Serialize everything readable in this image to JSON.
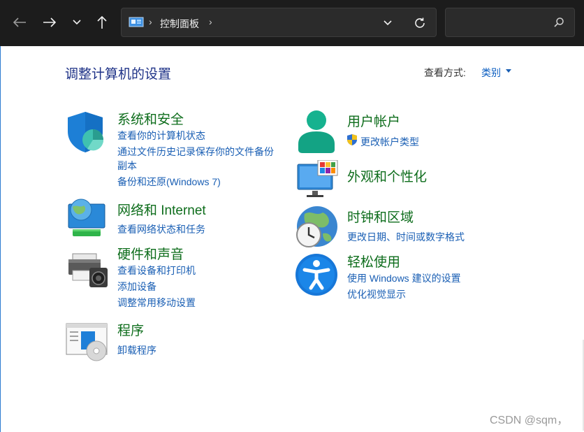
{
  "nav": {
    "address_root": "控制面板",
    "search_placeholder": ""
  },
  "page": {
    "title": "调整计算机的设置",
    "view_by_label": "查看方式:",
    "view_by_value": "类别"
  },
  "categories": {
    "system": {
      "title": "系统和安全",
      "links": [
        "查看你的计算机状态",
        "通过文件历史记录保存你的文件备份",
        "副本",
        "备份和还原(Windows 7)"
      ]
    },
    "network": {
      "title": "网络和 Internet",
      "links": [
        "查看网络状态和任务"
      ]
    },
    "hardware": {
      "title": "硬件和声音",
      "links": [
        "查看设备和打印机",
        "添加设备",
        "调整常用移动设置"
      ]
    },
    "programs": {
      "title": "程序",
      "links": [
        "卸载程序"
      ]
    },
    "users": {
      "title": "用户帐户",
      "links": [
        "更改帐户类型"
      ]
    },
    "appearance": {
      "title": "外观和个性化",
      "links": []
    },
    "clock": {
      "title": "时钟和区域",
      "links": [
        "更改日期、时间或数字格式"
      ]
    },
    "ease": {
      "title": "轻松使用",
      "links": [
        "使用 Windows 建议的设置",
        "优化视觉显示"
      ]
    }
  },
  "watermark": "CSDN @sqm，",
  "colors": {
    "navbar_bg": "#1c1c1c",
    "category_title": "#0e6d1c",
    "link": "#1a5fb4",
    "page_title": "#1e3287"
  }
}
